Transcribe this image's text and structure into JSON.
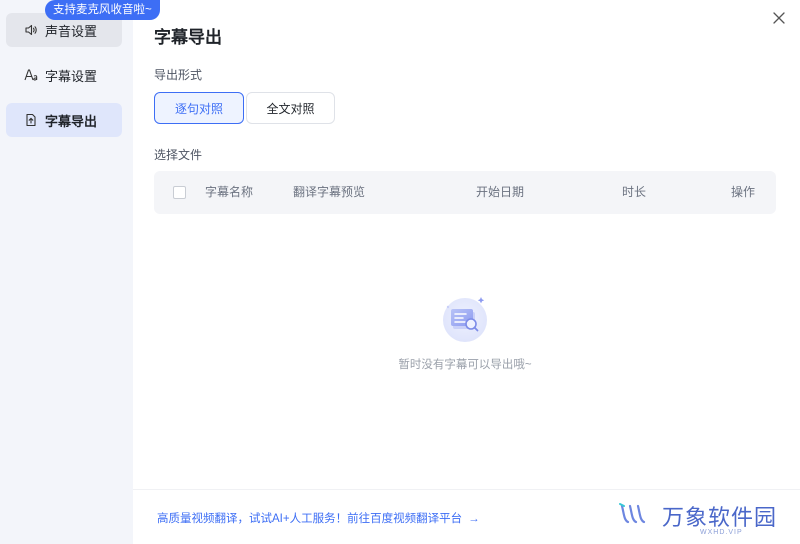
{
  "sidebar": {
    "badge": "支持麦克风收音啦~",
    "items": [
      {
        "label": "声音设置",
        "icon": "speaker-icon"
      },
      {
        "label": "字幕设置",
        "icon": "font-icon"
      },
      {
        "label": "字幕导出",
        "icon": "export-file-icon"
      }
    ]
  },
  "main": {
    "title": "字幕导出",
    "format_label": "导出形式",
    "format_options": [
      "逐句对照",
      "全文对照"
    ],
    "file_label": "选择文件",
    "table": {
      "columns": [
        "字幕名称",
        "翻译字幕预览",
        "开始日期",
        "时长",
        "操作"
      ]
    },
    "empty_text": "暂时没有字幕可以导出哦~"
  },
  "footer": {
    "link": "高质量视频翻译，试试AI+人工服务！前往百度视频翻译平台",
    "arrow": "→"
  },
  "watermark": {
    "text": "万象软件园",
    "url": "WXHD.VIP"
  },
  "colors": {
    "accent": "#3d6ef5",
    "sidebar_bg": "#f3f5fa",
    "active_nav_bg": "#dfe6fb"
  }
}
